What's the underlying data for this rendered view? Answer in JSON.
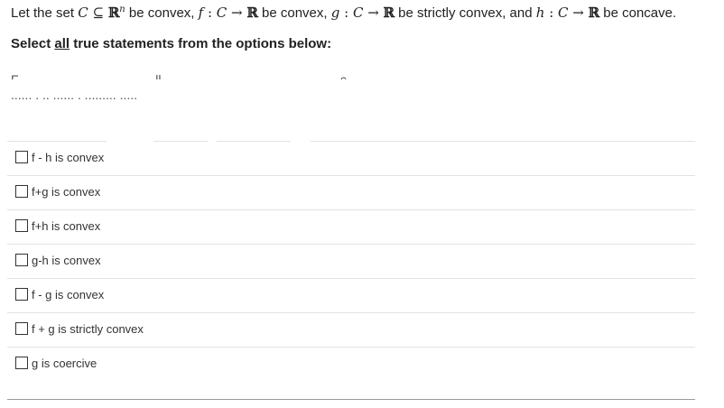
{
  "intro": {
    "lead": "Let the set ",
    "set_symbol": "C",
    "subset": " ⊆ ",
    "reals": "ℝ",
    "exponent": "n",
    "be_convex": " be convex, ",
    "f_name": "f",
    "map_colon": " : ",
    "domain_c": "C",
    "arrow": " → ",
    "codomain": "ℝ",
    "f_desc": " be convex, ",
    "g_name": "g",
    "g_desc": " be strictly convex, and ",
    "h_name": "h",
    "h_desc": " be concave."
  },
  "select_line": {
    "prefix": "Select ",
    "emph": "all",
    "suffix": " true statements from the options below:"
  },
  "obscured_text": {
    "line1": "F      ,  ..          ..  ...... ..... .. ..      ...... .  ..ll.  ..      ...   ...      .      . . ..   .. ....  ......     ..........  ...c.",
    "line2": "......           .              ..       ......          .               .........           ....."
  },
  "options": [
    {
      "label": "f - h is convex"
    },
    {
      "label": "f+g is convex"
    },
    {
      "label": "f+h is convex"
    },
    {
      "label": "g-h is convex"
    },
    {
      "label": "f - g is convex"
    },
    {
      "label": "f + g is strictly convex"
    },
    {
      "label": "g is coercive"
    }
  ]
}
